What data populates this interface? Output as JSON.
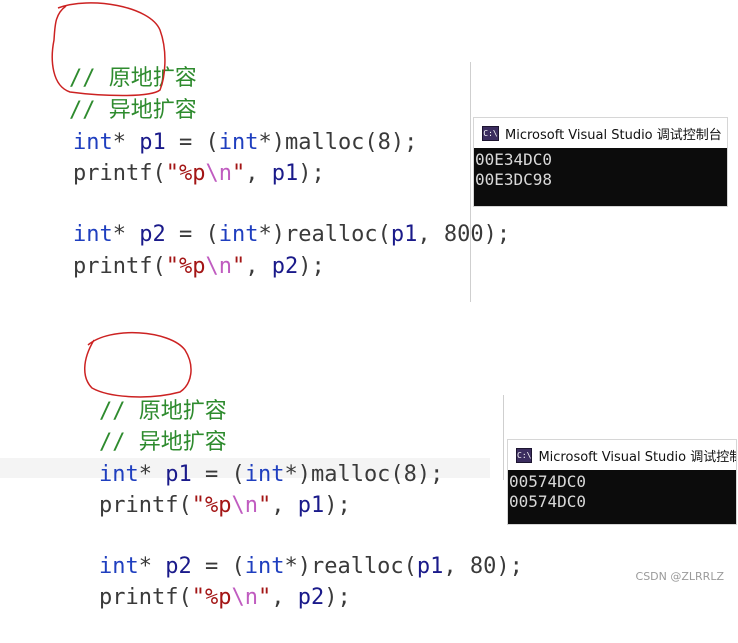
{
  "top_example": {
    "comment_1": "//",
    "comment_1_text": "原地扩容",
    "comment_2": "//",
    "comment_2_text": "异地扩容",
    "line_3_parts": [
      "int",
      "* ",
      "p1",
      " = (",
      "int",
      "*)malloc(8);"
    ],
    "line_4_parts": [
      "printf(",
      "\"%p",
      "\\n",
      "\"",
      ", ",
      "p1",
      ");"
    ],
    "line_6_parts": [
      "int",
      "* ",
      "p2",
      " = (",
      "int",
      "*)realloc(",
      "p1",
      ", 800);"
    ],
    "line_7_parts": [
      "printf(",
      "\"%p",
      "\\n",
      "\"",
      ", ",
      "p2",
      ");"
    ],
    "console": {
      "title": "Microsoft Visual Studio 调试控制台",
      "icon": "C:\\",
      "lines": [
        "00E34DC0",
        "00E3DC98"
      ]
    }
  },
  "bottom_example": {
    "comment_1": "//",
    "comment_1_text": "原地扩容",
    "comment_2": "//",
    "comment_2_text": "异地扩容",
    "line_3_parts": [
      "int",
      "* ",
      "p1",
      " = (",
      "int",
      "*)malloc(8);"
    ],
    "line_4_parts": [
      "printf(",
      "\"%p",
      "\\n",
      "\"",
      ", ",
      "p1",
      ");"
    ],
    "line_6_parts": [
      "int",
      "* ",
      "p2",
      " = (",
      "int",
      "*)realloc(",
      "p1",
      ", 80);"
    ],
    "line_7_parts": [
      "printf(",
      "\"%p",
      "\\n",
      "\"",
      ", ",
      "p2",
      ");"
    ],
    "console": {
      "title": "Microsoft Visual Studio 调试控制",
      "icon": "C:\\",
      "lines": [
        "00574DC0",
        "00574DC0"
      ]
    }
  },
  "watermark": "CSDN @ZLRRLZ",
  "colors": {
    "comment": "#2e8b2e",
    "keyword": "#1f3fbf",
    "string": "#a31515",
    "escape": "#c05cc0",
    "annotation_circle": "#cc2222",
    "console_bg": "#0c0c0c"
  }
}
